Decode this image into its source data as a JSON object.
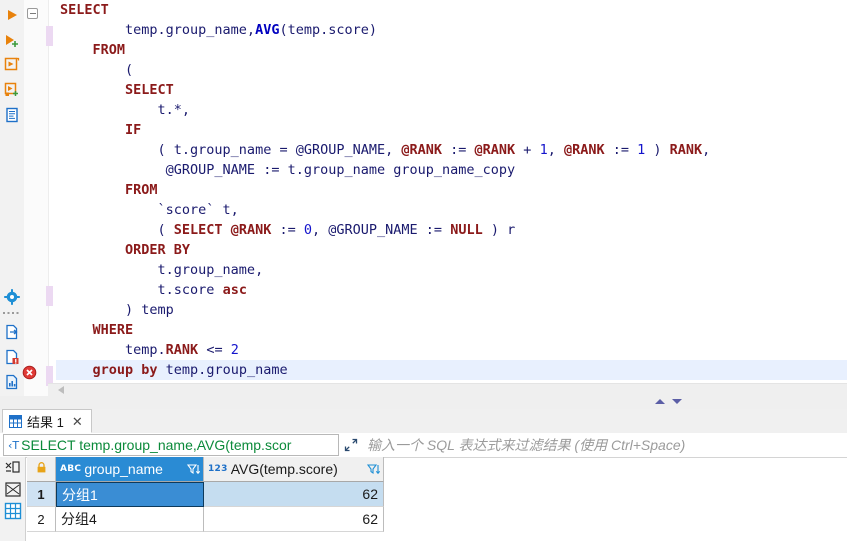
{
  "editor": {
    "toolbar_icons": [
      {
        "name": "execute-statement-icon",
        "title": "执行 SQL 语句"
      },
      {
        "name": "execute-script-icon",
        "title": "执行脚本"
      },
      {
        "name": "execute-new-tab-icon",
        "title": "在新标签中执行"
      },
      {
        "name": "execute-script-new-tab-icon",
        "title": "在新标签中执行脚本"
      },
      {
        "name": "explain-plan-icon",
        "title": "解释执行计划"
      },
      {
        "name": "settings-gear-icon",
        "title": "SQL 编辑器设置"
      },
      {
        "name": "export-data-icon",
        "title": "导出数据"
      },
      {
        "name": "script-warning-icon",
        "title": "脚本警告"
      },
      {
        "name": "data-chart-icon",
        "title": "数据图表"
      }
    ],
    "fold_marker": "⊖",
    "error_marker": "error-marker",
    "hscroll_arrow": "scroll-left-arrow",
    "change_bar_lines": [
      1,
      14,
      18
    ],
    "current_line_index": 18,
    "lines": [
      [
        {
          "t": "SELECT",
          "c": "kw"
        }
      ],
      [
        {
          "t": "        temp.group_name,",
          "c": "plain"
        },
        {
          "t": "AVG",
          "c": "func"
        },
        {
          "t": "(temp.score)",
          "c": "plain"
        }
      ],
      [
        {
          "t": "    ",
          "c": "plain"
        },
        {
          "t": "FROM",
          "c": "kw"
        }
      ],
      [
        {
          "t": "        (",
          "c": "plain"
        }
      ],
      [
        {
          "t": "        ",
          "c": "plain"
        },
        {
          "t": "SELECT",
          "c": "kw"
        }
      ],
      [
        {
          "t": "            t.*,",
          "c": "plain"
        }
      ],
      [
        {
          "t": "        ",
          "c": "plain"
        },
        {
          "t": "IF",
          "c": "kw"
        }
      ],
      [
        {
          "t": "            ( t.group_name = @GROUP_NAME, ",
          "c": "plain"
        },
        {
          "t": "@RANK",
          "c": "var"
        },
        {
          "t": " := ",
          "c": "plain"
        },
        {
          "t": "@RANK",
          "c": "var"
        },
        {
          "t": " + ",
          "c": "plain"
        },
        {
          "t": "1",
          "c": "num"
        },
        {
          "t": ", ",
          "c": "plain"
        },
        {
          "t": "@RANK",
          "c": "var"
        },
        {
          "t": " := ",
          "c": "plain"
        },
        {
          "t": "1",
          "c": "num"
        },
        {
          "t": " ) ",
          "c": "plain"
        },
        {
          "t": "RANK",
          "c": "var"
        },
        {
          "t": ",",
          "c": "plain"
        }
      ],
      [
        {
          "t": "             @GROUP_NAME := t.group_name group_name_copy",
          "c": "plain"
        }
      ],
      [
        {
          "t": "        ",
          "c": "plain"
        },
        {
          "t": "FROM",
          "c": "kw"
        }
      ],
      [
        {
          "t": "            `score` t,",
          "c": "plain"
        }
      ],
      [
        {
          "t": "            ( ",
          "c": "plain"
        },
        {
          "t": "SELECT",
          "c": "kw"
        },
        {
          "t": " ",
          "c": "plain"
        },
        {
          "t": "@RANK",
          "c": "var"
        },
        {
          "t": " := ",
          "c": "plain"
        },
        {
          "t": "0",
          "c": "num"
        },
        {
          "t": ", @GROUP_NAME := ",
          "c": "plain"
        },
        {
          "t": "NULL",
          "c": "kw"
        },
        {
          "t": " ) r",
          "c": "plain"
        }
      ],
      [
        {
          "t": "        ",
          "c": "plain"
        },
        {
          "t": "ORDER BY",
          "c": "kw"
        }
      ],
      [
        {
          "t": "            t.group_name,",
          "c": "plain"
        }
      ],
      [
        {
          "t": "            t.score ",
          "c": "plain"
        },
        {
          "t": "asc",
          "c": "kw"
        }
      ],
      [
        {
          "t": "        ) temp",
          "c": "plain"
        }
      ],
      [
        {
          "t": "    ",
          "c": "plain"
        },
        {
          "t": "WHERE",
          "c": "kw"
        }
      ],
      [
        {
          "t": "        temp.",
          "c": "plain"
        },
        {
          "t": "RANK",
          "c": "var"
        },
        {
          "t": " <= ",
          "c": "plain"
        },
        {
          "t": "2",
          "c": "num"
        }
      ],
      [
        {
          "t": "    ",
          "c": "plain"
        },
        {
          "t": "group by",
          "c": "kw"
        },
        {
          "t": " temp.group_name",
          "c": "plain"
        }
      ]
    ]
  },
  "splitter": {
    "collapse_up": "collapse-up-arrow",
    "collapse_down": "collapse-down-arrow"
  },
  "results": {
    "tab": {
      "label": "结果 1",
      "close": "✕",
      "icon": "grid-icon"
    },
    "filter": {
      "prefix_icon": "text-filter-icon",
      "value": "SELECT temp.group_name,AVG(temp.scor",
      "expand_icon": "expand-icon",
      "placeholder": "输入一个 SQL 表达式来过滤结果 (使用 Ctrl+Space)"
    },
    "sidebar_icons": [
      {
        "name": "grid-presentation-icon"
      },
      {
        "name": "record-view-icon"
      },
      {
        "name": "grid-view-icon"
      }
    ],
    "grid": {
      "lock_icon": "lock-icon",
      "columns": [
        {
          "name": "group_name",
          "type_badge": "ABC",
          "width": 148,
          "selected": true,
          "filter_icon": "filter-sort-icon"
        },
        {
          "name": "AVG(temp.score)",
          "type_badge": "123",
          "width": 180,
          "selected": false,
          "filter_icon": "filter-sort-icon"
        }
      ],
      "rows": [
        {
          "num": "1",
          "cells": [
            "分组1",
            "62"
          ],
          "selected_cell": 0,
          "active": true
        },
        {
          "num": "2",
          "cells": [
            "分组4",
            "62"
          ],
          "selected_cell": -1,
          "active": false
        }
      ]
    }
  },
  "colors": {
    "keyword": "#8b1a1a",
    "number": "#1414cc",
    "plain_text": "#1a1a6e",
    "grid_selection": "#3a8dd4",
    "header_selection": "#2a8bd4",
    "filter_text": "#0b8a3a",
    "change_bar": "#ecd9f2",
    "current_line": "#e8f0fe"
  }
}
